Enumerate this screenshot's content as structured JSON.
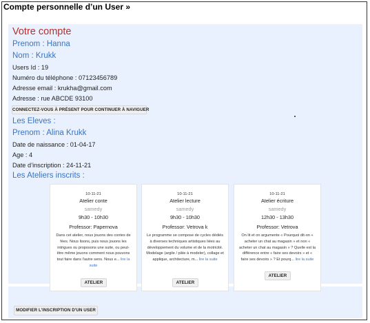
{
  "heading": "Compte personnelle d’un User »",
  "account": {
    "title": "Votre compte",
    "prenom": "Prenom : Hanna",
    "nom": "Nom : Krukk",
    "user_id": "Users Id : 19",
    "phone": "Numéro du téléphone : 07123456789",
    "email": "Adresse email : krukha@gmail.com",
    "address": "Adresse : rue ABCDE 93100",
    "connect_button": "CONNECTEZ-VOUS À PRÉSENT POUR CONTINUER À NAVIGUER"
  },
  "students": {
    "title": "Les Eleves :",
    "prenom": "Prenom : Alina Krukk",
    "birth": "Date de naissance : 01-04-17",
    "age": "Age : 4",
    "inscription": "Date d’inscription : 24-11-21",
    "ateliers_title": "Les Ateliers inscrits :"
  },
  "ateliers": [
    {
      "date": "10-11-21",
      "title": "Atelier conte",
      "day": "samedy",
      "time": "9h30 - 10h30",
      "professor": "Professor: Papernova",
      "description": "Dans cet atelier, nous jouons des contes de fées. Nous lisons, puis nous jouons les intrigues ou proposons une suite, ou peut-être même jouons comment nous pouvons tout faire dans l'autre sens. Nous e...",
      "more": "lire la suite",
      "button": "ATELIER"
    },
    {
      "date": "10-11-21",
      "title": "Atelier lecture",
      "day": "samedy",
      "time": "9h30 - 10h30",
      "professor": "Professor: Vetrova k",
      "description": "Le programme se compose de cycles dédiés à diverses techniques artistiques liées au développement du volume et de la motricité. Modelage (argile / pâte à modeler), collage et applique, architecture, m...",
      "more": "lire la suite",
      "button": "ATELIER"
    },
    {
      "date": "10-11-21",
      "title": "Atelier écriture",
      "day": "samedy",
      "time": "12h30 - 13h30",
      "professor": "Professor: Vetrova",
      "description": "On lit et on argumente « Pourquoi dit-on « acheter un chat au magasin » et non « acheter un chat au magasin » ? Quelle est la différence entre « faire ses devoirs » et « faire ses devoirs » ? Et pourq...",
      "more": "lire la suite",
      "button": "ATELIER"
    }
  ],
  "modify_button": "MODIFIER L'INSCRIPTION D'UN USER"
}
